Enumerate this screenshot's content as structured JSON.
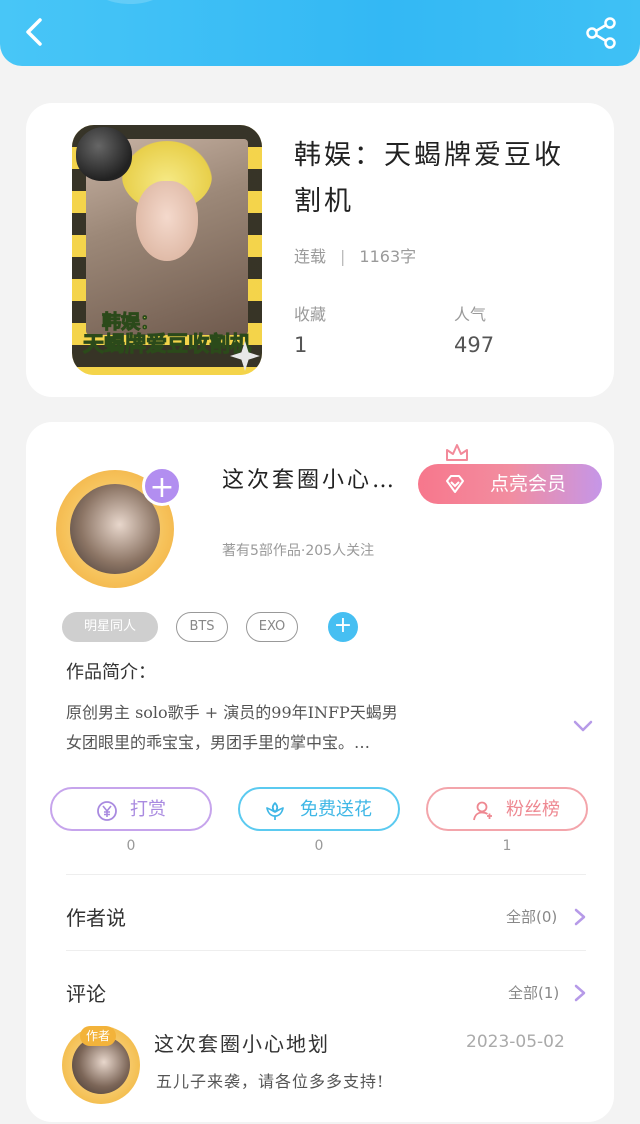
{
  "book": {
    "title": "韩娱：天蝎牌爱豆收割机",
    "status": "连载",
    "word_count": "1163字",
    "favorites_label": "收藏",
    "favorites_value": "1",
    "popularity_label": "人气",
    "popularity_value": "497",
    "cover_text_line1": "韩娱：",
    "cover_text_line2": "天蝎牌爱豆收割机"
  },
  "author": {
    "name": "这次套圈小心…",
    "summary": "著有5部作品·205人关注",
    "vip_label": "点亮会员",
    "follow_label": "+"
  },
  "tags": [
    "明星同人",
    "BTS",
    "EXO"
  ],
  "tag_add_label": "+",
  "intro": {
    "heading": "作品简介：",
    "line1": "原创男主 solo歌手 + 演员的99年INFP天蝎男",
    "line2": "女团眼里的乖宝宝，男团手里的掌中宝。…"
  },
  "actions": [
    {
      "label": "打赏",
      "count": "0",
      "icon": "yen-icon"
    },
    {
      "label": "免费送花",
      "count": "0",
      "icon": "flower-icon"
    },
    {
      "label": "粉丝榜",
      "count": "1",
      "icon": "user-icon"
    }
  ],
  "author_says": {
    "title": "作者说",
    "all_label": "全部(0)"
  },
  "comments": {
    "title": "评论",
    "all_label": "全部(1)",
    "items": [
      {
        "name": "这次套圈小心地划",
        "date": "2023-05-02",
        "text": "五儿子来袭，请各位多多支持!",
        "badge": "作者"
      }
    ]
  },
  "colors": {
    "accent_blue": "#33b8f4",
    "accent_purple": "#b28ef0",
    "accent_pink": "#f28da0"
  }
}
